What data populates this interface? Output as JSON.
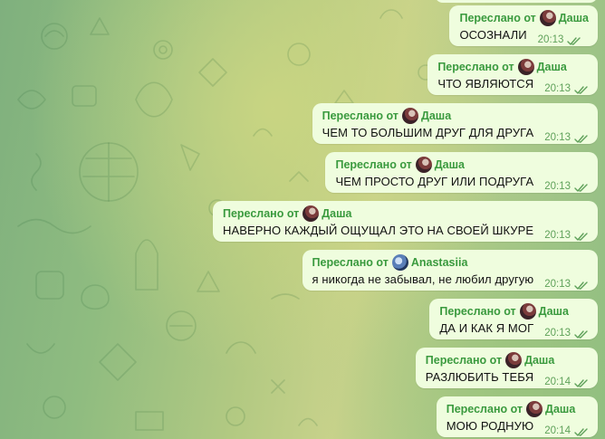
{
  "chat": {
    "forward_prefix": "Переслано от",
    "messages": [
      {
        "sender": "Даша",
        "avatar": "dasha-avatar",
        "text": "ОСОЗНАЛИ",
        "time": "20:13"
      },
      {
        "sender": "Даша",
        "avatar": "dasha-avatar",
        "text": "ЧТО ЯВЛЯЮТСЯ",
        "time": "20:13"
      },
      {
        "sender": "Даша",
        "avatar": "dasha-avatar",
        "text": "ЧЕМ ТО БОЛЬШИМ ДРУГ ДЛЯ ДРУГА",
        "time": "20:13"
      },
      {
        "sender": "Даша",
        "avatar": "dasha-avatar",
        "text": "ЧЕМ ПРОСТО ДРУГ ИЛИ ПОДРУГА",
        "time": "20:13"
      },
      {
        "sender": "Даша",
        "avatar": "dasha-avatar",
        "text": "НАВЕРНО КАЖДЫЙ ОЩУЩАЛ ЭТО НА СВОЕЙ ШКУРЕ",
        "time": "20:13"
      },
      {
        "sender": "Anastasiia",
        "avatar": "anastasiia-avatar",
        "text": "я никогда не забывал, не любил другую",
        "time": "20:13"
      },
      {
        "sender": "Даша",
        "avatar": "dasha-avatar",
        "text": "ДА И КАК Я МОГ",
        "time": "20:13"
      },
      {
        "sender": "Даша",
        "avatar": "dasha-avatar",
        "text": "РАЗЛЮБИТЬ ТЕБЯ",
        "time": "20:14"
      },
      {
        "sender": "Даша",
        "avatar": "dasha-avatar",
        "text": "МОЮ РОДНУЮ",
        "time": "20:14"
      }
    ],
    "read_status_icon": "double-check-icon",
    "colors": {
      "bubble": "#effdde",
      "forward_label": "#3a9a3e",
      "meta": "#5fa15a",
      "text": "#111111"
    }
  }
}
